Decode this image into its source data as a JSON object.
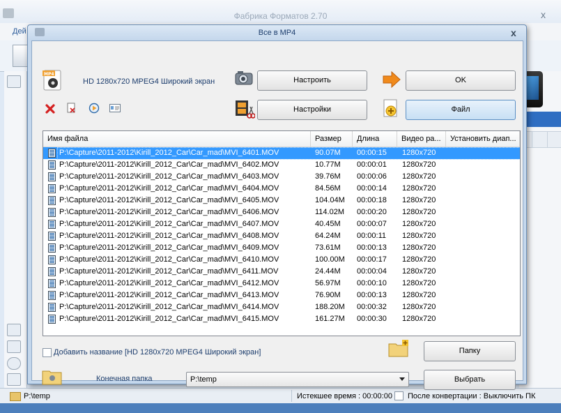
{
  "main_window": {
    "title": "Фабрика Форматов 2.70",
    "menu_first": "Дей",
    "close_glyph": "x",
    "status": {
      "path": "P:\\temp",
      "elapsed": "Истекшее время : 00:00:00",
      "after_conversion": "После конвертации : Выключить ПК"
    }
  },
  "dialog": {
    "title": "Все в MP4",
    "close_glyph": "x",
    "format_badge": "MP4",
    "format_label": "HD 1280x720 MPEG4 Широкий экран",
    "buttons": {
      "configure": "Настроить",
      "ok": "OK",
      "settings": "Настройки",
      "file": "Файл",
      "folder": "Папку",
      "choose": "Выбрать"
    },
    "table": {
      "headers": [
        "Имя файла",
        "Размер",
        "Длина",
        "Видео ра...",
        "Установить диап..."
      ],
      "rows": [
        {
          "name": "P:\\Capture\\2011-2012\\Kirill_2012_Car\\Car_mad\\MVI_6401.MOV",
          "size": "90.07M",
          "length": "00:00:15",
          "video": "1280x720"
        },
        {
          "name": "P:\\Capture\\2011-2012\\Kirill_2012_Car\\Car_mad\\MVI_6402.MOV",
          "size": "10.77M",
          "length": "00:00:01",
          "video": "1280x720"
        },
        {
          "name": "P:\\Capture\\2011-2012\\Kirill_2012_Car\\Car_mad\\MVI_6403.MOV",
          "size": "39.76M",
          "length": "00:00:06",
          "video": "1280x720"
        },
        {
          "name": "P:\\Capture\\2011-2012\\Kirill_2012_Car\\Car_mad\\MVI_6404.MOV",
          "size": "84.56M",
          "length": "00:00:14",
          "video": "1280x720"
        },
        {
          "name": "P:\\Capture\\2011-2012\\Kirill_2012_Car\\Car_mad\\MVI_6405.MOV",
          "size": "104.04M",
          "length": "00:00:18",
          "video": "1280x720"
        },
        {
          "name": "P:\\Capture\\2011-2012\\Kirill_2012_Car\\Car_mad\\MVI_6406.MOV",
          "size": "114.02M",
          "length": "00:00:20",
          "video": "1280x720"
        },
        {
          "name": "P:\\Capture\\2011-2012\\Kirill_2012_Car\\Car_mad\\MVI_6407.MOV",
          "size": "40.45M",
          "length": "00:00:07",
          "video": "1280x720"
        },
        {
          "name": "P:\\Capture\\2011-2012\\Kirill_2012_Car\\Car_mad\\MVI_6408.MOV",
          "size": "64.24M",
          "length": "00:00:11",
          "video": "1280x720"
        },
        {
          "name": "P:\\Capture\\2011-2012\\Kirill_2012_Car\\Car_mad\\MVI_6409.MOV",
          "size": "73.61M",
          "length": "00:00:13",
          "video": "1280x720"
        },
        {
          "name": "P:\\Capture\\2011-2012\\Kirill_2012_Car\\Car_mad\\MVI_6410.MOV",
          "size": "100.00M",
          "length": "00:00:17",
          "video": "1280x720"
        },
        {
          "name": "P:\\Capture\\2011-2012\\Kirill_2012_Car\\Car_mad\\MVI_6411.MOV",
          "size": "24.44M",
          "length": "00:00:04",
          "video": "1280x720"
        },
        {
          "name": "P:\\Capture\\2011-2012\\Kirill_2012_Car\\Car_mad\\MVI_6412.MOV",
          "size": "56.97M",
          "length": "00:00:10",
          "video": "1280x720"
        },
        {
          "name": "P:\\Capture\\2011-2012\\Kirill_2012_Car\\Car_mad\\MVI_6413.MOV",
          "size": "76.90M",
          "length": "00:00:13",
          "video": "1280x720"
        },
        {
          "name": "P:\\Capture\\2011-2012\\Kirill_2012_Car\\Car_mad\\MVI_6414.MOV",
          "size": "188.20M",
          "length": "00:00:32",
          "video": "1280x720"
        },
        {
          "name": "P:\\Capture\\2011-2012\\Kirill_2012_Car\\Car_mad\\MVI_6415.MOV",
          "size": "161.27M",
          "length": "00:00:30",
          "video": "1280x720"
        }
      ],
      "selected_index": 0
    },
    "add_name_label": "Добавить название [HD 1280x720 MPEG4 Широкий экран]",
    "destination_label": "Конечная папка",
    "destination_value": "P:\\temp"
  },
  "colors": {
    "selection": "#3399ff",
    "title_text": "#1b3c6c",
    "delete_icon": "#d42020",
    "arrow_icon": "#f08a1c"
  },
  "icons": [
    "mp4-format-icon",
    "camera-icon",
    "arrow-right-icon",
    "film-scissors-icon",
    "add-file-icon",
    "delete-icon",
    "clear-list-icon",
    "play-icon",
    "media-info-icon",
    "folder-add-icon",
    "folder-icon"
  ]
}
